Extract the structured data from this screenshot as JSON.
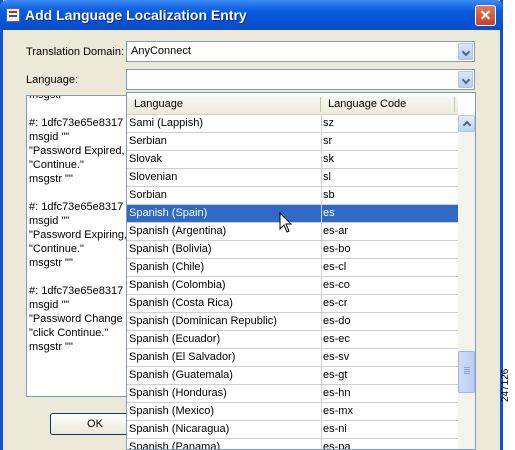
{
  "window": {
    "title": "Add Language Localization Entry"
  },
  "translation_domain": {
    "label": "Translation Domain:",
    "value": "AnyConnect"
  },
  "language": {
    "label": "Language:",
    "value": ""
  },
  "editor_lines": [
    "msgstr \"\"",
    "",
    "#: 1dfc73e65e8317",
    "msgid \"\"",
    "\"Password Expired, l",
    "\"Continue.\"",
    "msgstr \"\"",
    "",
    "#: 1dfc73e65e8317",
    "msgid \"\"",
    "\"Password Expiring,",
    "\"Continue.\"",
    "msgstr \"\"",
    "",
    "#: 1dfc73e65e8317",
    "msgid \"\"",
    "\"Password Change R",
    "\"click Continue.\"",
    "msgstr \"\""
  ],
  "ok_button": {
    "label": "OK"
  },
  "language_list": {
    "columns": [
      "Language",
      "Language Code"
    ],
    "selected_index": 5,
    "rows": [
      {
        "name": "Sami (Lappish)",
        "code": "sz"
      },
      {
        "name": "Serbian",
        "code": "sr"
      },
      {
        "name": "Slovak",
        "code": "sk"
      },
      {
        "name": "Slovenian",
        "code": "sl"
      },
      {
        "name": "Sorbian",
        "code": "sb"
      },
      {
        "name": "Spanish (Spain)",
        "code": "es"
      },
      {
        "name": "Spanish (Argentina)",
        "code": "es-ar"
      },
      {
        "name": "Spanish (Bolivia)",
        "code": "es-bo"
      },
      {
        "name": "Spanish (Chile)",
        "code": "es-cl"
      },
      {
        "name": "Spanish (Colombia)",
        "code": "es-co"
      },
      {
        "name": "Spanish (Costa Rica)",
        "code": "es-cr"
      },
      {
        "name": "Spanish (Dominican Republic)",
        "code": "es-do"
      },
      {
        "name": "Spanish (Ecuador)",
        "code": "es-ec"
      },
      {
        "name": "Spanish (El Salvador)",
        "code": "es-sv"
      },
      {
        "name": "Spanish (Guatemala)",
        "code": "es-gt"
      },
      {
        "name": "Spanish (Honduras)",
        "code": "es-hn"
      },
      {
        "name": "Spanish (Mexico)",
        "code": "es-mx"
      },
      {
        "name": "Spanish (Nicaragua)",
        "code": "es-ni"
      },
      {
        "name": "Spanish (Panama)",
        "code": "es-pa"
      }
    ]
  },
  "figure_id": "247126",
  "colors": {
    "titlebar": "#0a5de3",
    "selection": "#316ac5",
    "dialog_bg": "#ece9d8"
  }
}
